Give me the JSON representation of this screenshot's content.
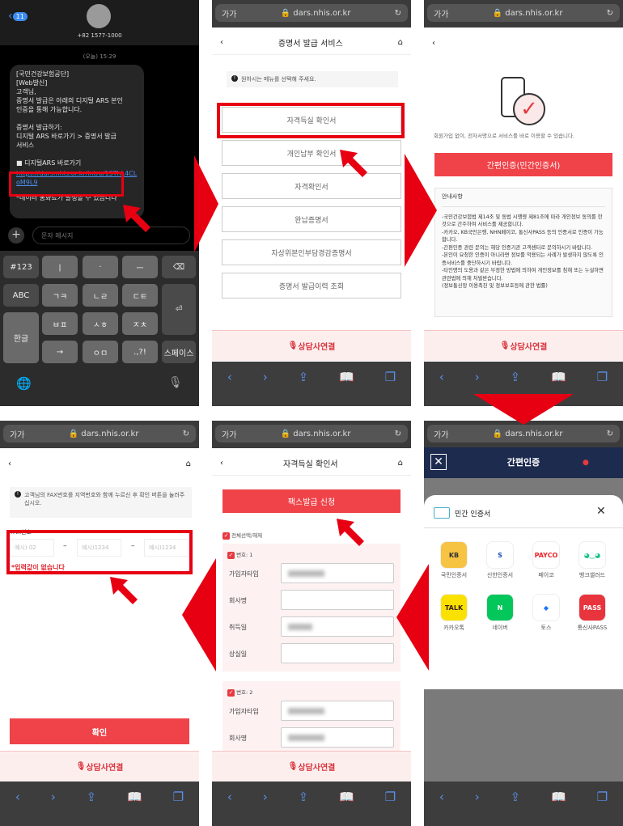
{
  "colors": {
    "accent": "#ef4349",
    "highlight": "#e60012",
    "navy": "#1d2b4f"
  },
  "sms": {
    "back_badge": "11",
    "sender": "+82 1577-1000",
    "date": "(오늘) 15:29",
    "message_lines": [
      "[국민건강보험공단]",
      "[Web발신]",
      "고객님,",
      "증명서 발급은 아래의 디지털 ARS 본인",
      "인증을 통해 가능합니다.",
      "",
      "증명서 발급하기:",
      "디지털 ARS 바로가기 > 증명서 발급",
      "서비스",
      "",
      "■ 디지털ARS 바로가기"
    ],
    "link": "https://dars.nhis.or.kr/intro/15ThL4CLoM9L9",
    "footer": "*데이터 통화료가 발생할 수 있습니다",
    "input_placeholder": "문자 메시지",
    "keys": [
      "#123",
      "ㅣ",
      "·",
      "ㅡ",
      "⌫",
      "ABC",
      "ㄱㅋ",
      "ㄴㄹ",
      "ㄷㅌ",
      "⏎",
      "한글",
      "ㅂㅍ",
      "ㅅㅎ",
      "ㅈㅊ",
      "→",
      "ㅇㅁ",
      ".,?!",
      "스페이스"
    ]
  },
  "browser": {
    "text_size": "가가",
    "url": "dars.nhis.or.kr",
    "lock": "🔒",
    "reload": "↻",
    "toolbar": [
      "‹",
      "›",
      "⇪",
      "📖",
      "❐"
    ]
  },
  "menu_screen": {
    "title": "증명서 발급 서비스",
    "notice": "원하시는 메뉴를 선택해 주세요.",
    "items": [
      "자격득실 확인서",
      "개인납부 확인서",
      "자격확인서",
      "완납증명서",
      "자상위본인부담경감증명서",
      "증명서 발급이력 조회"
    ]
  },
  "auth_screen": {
    "subtitle": "회원가입 없이, 전자서명으로 서비스를 바로 이용할 수 있습니다.",
    "button": "간편인증(민간인증서)",
    "notice_title": "안내사항",
    "notice_lines": [
      "-국민건강보험법 제14조 및 동법 시행령 제81조에 따라 개인정보 동의를 한것으로 간주하여 서비스를 제공합니다.",
      "-카카오, KB국민은행, NHN페이코, 통신사PASS 등의 인증서로 인증이 가능합니다.",
      "-간편인증 관련 문의는 해당 인증기관 고객센터로 문의하시기 바랍니다.",
      "-본인이 요청한 인증이 아니라면 정보를 악용되는 사례가 발생하지 않도록 인증서비스를 중단하시기 바랍니다.",
      "-타인명의 도용과 같은 부정한 방법에 의하여 개인정보를 침해 또는 누설하면 관련법에 의해 처벌받습니다.",
      "(정보통신망 이용촉진 및 정보보호등에 관한 법률)"
    ]
  },
  "consult": "상담사연결",
  "fax_screen": {
    "notice": "고객님의 FAX번호를 지역번호와 함께 누르신 후 확인 버튼을 눌러주십시오.",
    "label": "FAX번호",
    "placeholders": [
      "예시) 02",
      "예시)1234",
      "예시)1234"
    ],
    "dash": "–",
    "error": "*입력값이 없습니다",
    "confirm": "확인"
  },
  "cert_screen": {
    "title": "자격득실 확인서",
    "fax_button": "팩스발급 신청",
    "select_all": "전체선택/해제",
    "groups": [
      {
        "label": "번호: 1",
        "fields": [
          "가입자타입",
          "회사명",
          "취득일",
          "상실일"
        ]
      },
      {
        "label": "번호: 2",
        "fields": [
          "가입자타입",
          "회사명"
        ]
      }
    ]
  },
  "simple_auth": {
    "header": "간편인증",
    "sheet_title": "민간 인증서",
    "providers": [
      {
        "name": "국민인증서",
        "icon": "KB",
        "bg": "#f6c343",
        "fg": "#333"
      },
      {
        "name": "신한인증서",
        "icon": "S",
        "bg": "#ffffff",
        "fg": "#1b4fb3"
      },
      {
        "name": "페이코",
        "icon": "PAYCO",
        "bg": "#ffffff",
        "fg": "#e8262c"
      },
      {
        "name": "뱅크샐러드",
        "icon": "◕‿◕",
        "bg": "#ffffff",
        "fg": "#22c08a"
      },
      {
        "name": "카카오톡",
        "icon": "TALK",
        "bg": "#fae100",
        "fg": "#3a1d1d"
      },
      {
        "name": "네이버",
        "icon": "N",
        "bg": "#03c75a",
        "fg": "#ffffff"
      },
      {
        "name": "토스",
        "icon": "◆",
        "bg": "#ffffff",
        "fg": "#1a74ff"
      },
      {
        "name": "통신사PASS",
        "icon": "PASS",
        "bg": "#e8343c",
        "fg": "#ffffff"
      }
    ]
  }
}
